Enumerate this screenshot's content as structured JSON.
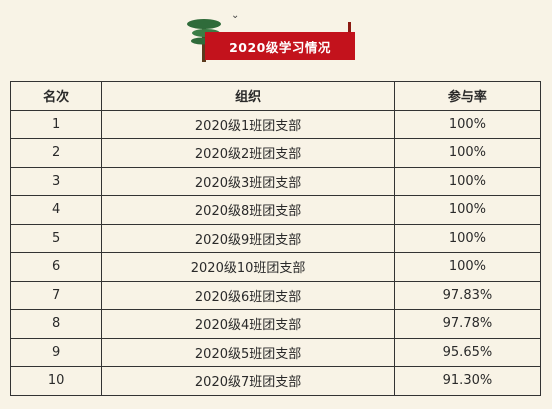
{
  "header": {
    "title": "2020级学习情况"
  },
  "table": {
    "columns": [
      "名次",
      "组织",
      "参与率"
    ],
    "rows": [
      {
        "rank": "1",
        "org": "2020级1班团支部",
        "rate": "100%"
      },
      {
        "rank": "2",
        "org": "2020级2班团支部",
        "rate": "100%"
      },
      {
        "rank": "3",
        "org": "2020级3班团支部",
        "rate": "100%"
      },
      {
        "rank": "4",
        "org": "2020级8班团支部",
        "rate": "100%"
      },
      {
        "rank": "5",
        "org": "2020级9班团支部",
        "rate": "100%"
      },
      {
        "rank": "6",
        "org": "2020级10班团支部",
        "rate": "100%"
      },
      {
        "rank": "7",
        "org": "2020级6班团支部",
        "rate": "97.83%"
      },
      {
        "rank": "8",
        "org": "2020级4班团支部",
        "rate": "97.78%"
      },
      {
        "rank": "9",
        "org": "2020级5班团支部",
        "rate": "95.65%"
      },
      {
        "rank": "10",
        "org": "2020级7班团支部",
        "rate": "91.30%"
      }
    ]
  },
  "colors": {
    "background": "#f8f3e6",
    "banner": "#c3121c",
    "border": "#333333"
  }
}
